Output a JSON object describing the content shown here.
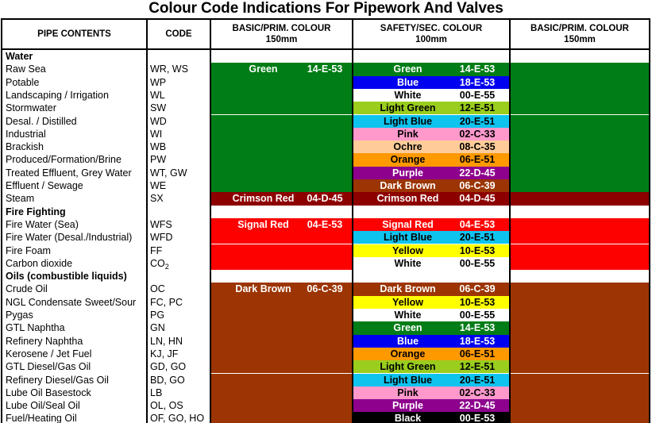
{
  "title": "Colour Code Indications For Pipework And Valves",
  "header": {
    "columns": [
      {
        "line1": "PIPE CONTENTS",
        "line2": ""
      },
      {
        "line1": "CODE",
        "line2": ""
      },
      {
        "line1": "BASIC/PRIM. COLOUR",
        "line2": "150mm"
      },
      {
        "line1": "SAFETY/SEC. COLOUR",
        "line2": "100mm"
      },
      {
        "line1": "BASIC/PRIM. COLOUR",
        "line2": "150mm"
      }
    ]
  },
  "palette": {
    "green": "#007d16",
    "blue": "#0000f0",
    "white": "#ffffff",
    "light_green": "#9acd1e",
    "light_blue": "#0fc3ef",
    "pink": "#ff99cc",
    "ochre": "#ffcc99",
    "orange": "#ff9900",
    "purple": "#8d018d",
    "dark_brown": "#9c3503",
    "crimson_red": "#8d0000",
    "signal_red": "#fd0000",
    "yellow": "#ffff00",
    "black": "#000000"
  },
  "rows": [
    {
      "kind": "section",
      "name": "Water",
      "code": "",
      "basic": null,
      "safety": null,
      "prim": null
    },
    {
      "kind": "item",
      "name": "Raw Sea",
      "code": "WR, WS",
      "basic": {
        "label": "Green",
        "code": "14-E-53",
        "bg": "#007d16",
        "fg": "#ffffff"
      },
      "safety": {
        "label": "Green",
        "code": "14-E-53",
        "bg": "#007d16",
        "fg": "#ffffff"
      },
      "prim": {
        "label": "",
        "code": "",
        "bg": "#007d16",
        "fg": "#ffffff"
      }
    },
    {
      "kind": "item",
      "name": "Potable",
      "code": "WP",
      "basic": {
        "label": "",
        "code": "",
        "bg": "#007d16",
        "fg": "#ffffff"
      },
      "safety": {
        "label": "Blue",
        "code": "18-E-53",
        "bg": "#0000f0",
        "fg": "#ffffff"
      },
      "prim": {
        "label": "",
        "code": "",
        "bg": "#007d16",
        "fg": "#ffffff"
      }
    },
    {
      "kind": "item",
      "name": "Landscaping / Irrigation",
      "code": "WL",
      "basic": {
        "label": "",
        "code": "",
        "bg": "#007d16",
        "fg": "#ffffff"
      },
      "safety": {
        "label": "White",
        "code": "00-E-55",
        "bg": "#ffffff",
        "fg": "#000000"
      },
      "prim": {
        "label": "",
        "code": "",
        "bg": "#007d16",
        "fg": "#ffffff"
      }
    },
    {
      "kind": "item",
      "name": "Stormwater",
      "code": "SW",
      "basic": {
        "label": "",
        "code": "",
        "bg": "#007d16",
        "fg": "#ffffff"
      },
      "safety": {
        "label": "Light Green",
        "code": "12-E-51",
        "bg": "#9acd1e",
        "fg": "#000000"
      },
      "prim": {
        "label": "",
        "code": "",
        "bg": "#007d16",
        "fg": "#ffffff"
      }
    },
    {
      "kind": "item",
      "name": "Desal. / Distilled",
      "code": "WD",
      "basic": {
        "label": "",
        "code": "",
        "bg": "#007d16",
        "fg": "#ffffff"
      },
      "safety": {
        "label": "Light Blue",
        "code": "20-E-51",
        "bg": "#0fc3ef",
        "fg": "#000000"
      },
      "prim": {
        "label": "",
        "code": "",
        "bg": "#007d16",
        "fg": "#ffffff"
      }
    },
    {
      "kind": "item",
      "name": "Industrial",
      "code": "WI",
      "basic": {
        "label": "",
        "code": "",
        "bg": "#007d16",
        "fg": "#ffffff"
      },
      "safety": {
        "label": "Pink",
        "code": "02-C-33",
        "bg": "#ff99cc",
        "fg": "#000000"
      },
      "prim": {
        "label": "",
        "code": "",
        "bg": "#007d16",
        "fg": "#ffffff"
      }
    },
    {
      "kind": "item",
      "name": "Brackish",
      "code": "WB",
      "basic": {
        "label": "",
        "code": "",
        "bg": "#007d16",
        "fg": "#ffffff"
      },
      "safety": {
        "label": "Ochre",
        "code": "08-C-35",
        "bg": "#ffcc99",
        "fg": "#000000"
      },
      "prim": {
        "label": "",
        "code": "",
        "bg": "#007d16",
        "fg": "#ffffff"
      }
    },
    {
      "kind": "item",
      "name": "Produced/Formation/Brine",
      "code": "PW",
      "basic": {
        "label": "",
        "code": "",
        "bg": "#007d16",
        "fg": "#ffffff"
      },
      "safety": {
        "label": "Orange",
        "code": "06-E-51",
        "bg": "#ff9900",
        "fg": "#000000"
      },
      "prim": {
        "label": "",
        "code": "",
        "bg": "#007d16",
        "fg": "#ffffff"
      }
    },
    {
      "kind": "item",
      "name": "Treated Effluent, Grey Water",
      "code": "WT, GW",
      "basic": {
        "label": "",
        "code": "",
        "bg": "#007d16",
        "fg": "#ffffff"
      },
      "safety": {
        "label": "Purple",
        "code": "22-D-45",
        "bg": "#8d018d",
        "fg": "#ffffff"
      },
      "prim": {
        "label": "",
        "code": "",
        "bg": "#007d16",
        "fg": "#ffffff"
      }
    },
    {
      "kind": "item",
      "name": "Effluent / Sewage",
      "code": "WE",
      "basic": {
        "label": "",
        "code": "",
        "bg": "#007d16",
        "fg": "#ffffff"
      },
      "safety": {
        "label": "Dark Brown",
        "code": "06-C-39",
        "bg": "#9c3503",
        "fg": "#ffffff"
      },
      "prim": {
        "label": "",
        "code": "",
        "bg": "#007d16",
        "fg": "#ffffff"
      }
    },
    {
      "kind": "item",
      "name": "Steam",
      "code": "SX",
      "basic": {
        "label": "Crimson Red",
        "code": "04-D-45",
        "bg": "#8d0000",
        "fg": "#ffffff"
      },
      "safety": {
        "label": "Crimson Red",
        "code": "04-D-45",
        "bg": "#8d0000",
        "fg": "#ffffff"
      },
      "prim": {
        "label": "",
        "code": "",
        "bg": "#8d0000",
        "fg": "#ffffff"
      }
    },
    {
      "kind": "section",
      "name": "Fire Fighting",
      "code": "",
      "basic": null,
      "safety": null,
      "prim": null
    },
    {
      "kind": "item",
      "name": "Fire Water (Sea)",
      "code": "WFS",
      "basic": {
        "label": "Signal Red",
        "code": "04-E-53",
        "bg": "#fd0000",
        "fg": "#ffffff"
      },
      "safety": {
        "label": "Signal Red",
        "code": "04-E-53",
        "bg": "#fd0000",
        "fg": "#ffffff"
      },
      "prim": {
        "label": "",
        "code": "",
        "bg": "#fd0000",
        "fg": "#ffffff"
      }
    },
    {
      "kind": "item",
      "name": "Fire Water (Desal./Industrial)",
      "code": "WFD",
      "basic": {
        "label": "",
        "code": "",
        "bg": "#fd0000",
        "fg": "#ffffff"
      },
      "safety": {
        "label": "Light Blue",
        "code": "20-E-51",
        "bg": "#0fc3ef",
        "fg": "#000000"
      },
      "prim": {
        "label": "",
        "code": "",
        "bg": "#fd0000",
        "fg": "#ffffff"
      }
    },
    {
      "kind": "item",
      "name": "Fire Foam",
      "code": "FF",
      "basic": {
        "label": "",
        "code": "",
        "bg": "#fd0000",
        "fg": "#ffffff"
      },
      "safety": {
        "label": "Yellow",
        "code": "10-E-53",
        "bg": "#ffff00",
        "fg": "#000000"
      },
      "prim": {
        "label": "",
        "code": "",
        "bg": "#fd0000",
        "fg": "#ffffff"
      }
    },
    {
      "kind": "item",
      "name": "Carbon dioxide",
      "code": "CO2",
      "code_sub": "2",
      "basic": {
        "label": "",
        "code": "",
        "bg": "#fd0000",
        "fg": "#ffffff"
      },
      "safety": {
        "label": "White",
        "code": "00-E-55",
        "bg": "#ffffff",
        "fg": "#000000"
      },
      "prim": {
        "label": "",
        "code": "",
        "bg": "#fd0000",
        "fg": "#ffffff"
      }
    },
    {
      "kind": "section",
      "name": "Oils  (combustible liquids)",
      "code": "",
      "basic": null,
      "safety": null,
      "prim": null
    },
    {
      "kind": "item",
      "name": "Crude Oil",
      "code": "OC",
      "basic": {
        "label": "Dark Brown",
        "code": "06-C-39",
        "bg": "#9c3503",
        "fg": "#ffffff"
      },
      "safety": {
        "label": "Dark Brown",
        "code": "06-C-39",
        "bg": "#9c3503",
        "fg": "#ffffff"
      },
      "prim": {
        "label": "",
        "code": "",
        "bg": "#9c3503",
        "fg": "#ffffff"
      }
    },
    {
      "kind": "item",
      "name": "NGL Condensate Sweet/Sour",
      "code": "FC, PC",
      "basic": {
        "label": "",
        "code": "",
        "bg": "#9c3503",
        "fg": "#ffffff"
      },
      "safety": {
        "label": "Yellow",
        "code": "10-E-53",
        "bg": "#ffff00",
        "fg": "#000000"
      },
      "prim": {
        "label": "",
        "code": "",
        "bg": "#9c3503",
        "fg": "#ffffff"
      }
    },
    {
      "kind": "item",
      "name": "Pygas",
      "code": "PG",
      "basic": {
        "label": "",
        "code": "",
        "bg": "#9c3503",
        "fg": "#ffffff"
      },
      "safety": {
        "label": "White",
        "code": "00-E-55",
        "bg": "#ffffff",
        "fg": "#000000"
      },
      "prim": {
        "label": "",
        "code": "",
        "bg": "#9c3503",
        "fg": "#ffffff"
      }
    },
    {
      "kind": "item",
      "name": "GTL Naphtha",
      "code": "GN",
      "basic": {
        "label": "",
        "code": "",
        "bg": "#9c3503",
        "fg": "#ffffff"
      },
      "safety": {
        "label": "Green",
        "code": "14-E-53",
        "bg": "#007d16",
        "fg": "#ffffff"
      },
      "prim": {
        "label": "",
        "code": "",
        "bg": "#9c3503",
        "fg": "#ffffff"
      }
    },
    {
      "kind": "item",
      "name": "Refinery Naphtha",
      "code": "LN, HN",
      "basic": {
        "label": "",
        "code": "",
        "bg": "#9c3503",
        "fg": "#ffffff"
      },
      "safety": {
        "label": "Blue",
        "code": "18-E-53",
        "bg": "#0000f0",
        "fg": "#ffffff"
      },
      "prim": {
        "label": "",
        "code": "",
        "bg": "#9c3503",
        "fg": "#ffffff"
      }
    },
    {
      "kind": "item",
      "name": "Kerosene / Jet Fuel",
      "code": "KJ, JF",
      "basic": {
        "label": "",
        "code": "",
        "bg": "#9c3503",
        "fg": "#ffffff"
      },
      "safety": {
        "label": "Orange",
        "code": "06-E-51",
        "bg": "#ff9900",
        "fg": "#000000"
      },
      "prim": {
        "label": "",
        "code": "",
        "bg": "#9c3503",
        "fg": "#ffffff"
      }
    },
    {
      "kind": "item",
      "name": "GTL Diesel/Gas Oil",
      "code": "GD, GO",
      "basic": {
        "label": "",
        "code": "",
        "bg": "#9c3503",
        "fg": "#ffffff"
      },
      "safety": {
        "label": "Light Green",
        "code": "12-E-51",
        "bg": "#9acd1e",
        "fg": "#000000"
      },
      "prim": {
        "label": "",
        "code": "",
        "bg": "#9c3503",
        "fg": "#ffffff"
      }
    },
    {
      "kind": "item",
      "name": "Refinery Diesel/Gas Oil",
      "code": "BD, GO",
      "basic": {
        "label": "",
        "code": "",
        "bg": "#9c3503",
        "fg": "#ffffff"
      },
      "safety": {
        "label": "Light Blue",
        "code": "20-E-51",
        "bg": "#0fc3ef",
        "fg": "#000000"
      },
      "prim": {
        "label": "",
        "code": "",
        "bg": "#9c3503",
        "fg": "#ffffff"
      }
    },
    {
      "kind": "item",
      "name": "Lube Oil Basestock",
      "code": "LB",
      "basic": {
        "label": "",
        "code": "",
        "bg": "#9c3503",
        "fg": "#ffffff"
      },
      "safety": {
        "label": "Pink",
        "code": "02-C-33",
        "bg": "#ff99cc",
        "fg": "#000000"
      },
      "prim": {
        "label": "",
        "code": "",
        "bg": "#9c3503",
        "fg": "#ffffff"
      }
    },
    {
      "kind": "item",
      "name": "Lube Oil/Seal Oil",
      "code": "OL, OS",
      "basic": {
        "label": "",
        "code": "",
        "bg": "#9c3503",
        "fg": "#ffffff"
      },
      "safety": {
        "label": "Purple",
        "code": "22-D-45",
        "bg": "#8d018d",
        "fg": "#ffffff"
      },
      "prim": {
        "label": "",
        "code": "",
        "bg": "#9c3503",
        "fg": "#ffffff"
      }
    },
    {
      "kind": "item",
      "name": "Fuel/Heating Oil",
      "code": "OF, GO, HO",
      "basic": {
        "label": "",
        "code": "",
        "bg": "#9c3503",
        "fg": "#ffffff"
      },
      "safety": {
        "label": "Black",
        "code": "00-E-53",
        "bg": "#000000",
        "fg": "#ffffff"
      },
      "prim": {
        "label": "",
        "code": "",
        "bg": "#9c3503",
        "fg": "#ffffff"
      }
    }
  ]
}
